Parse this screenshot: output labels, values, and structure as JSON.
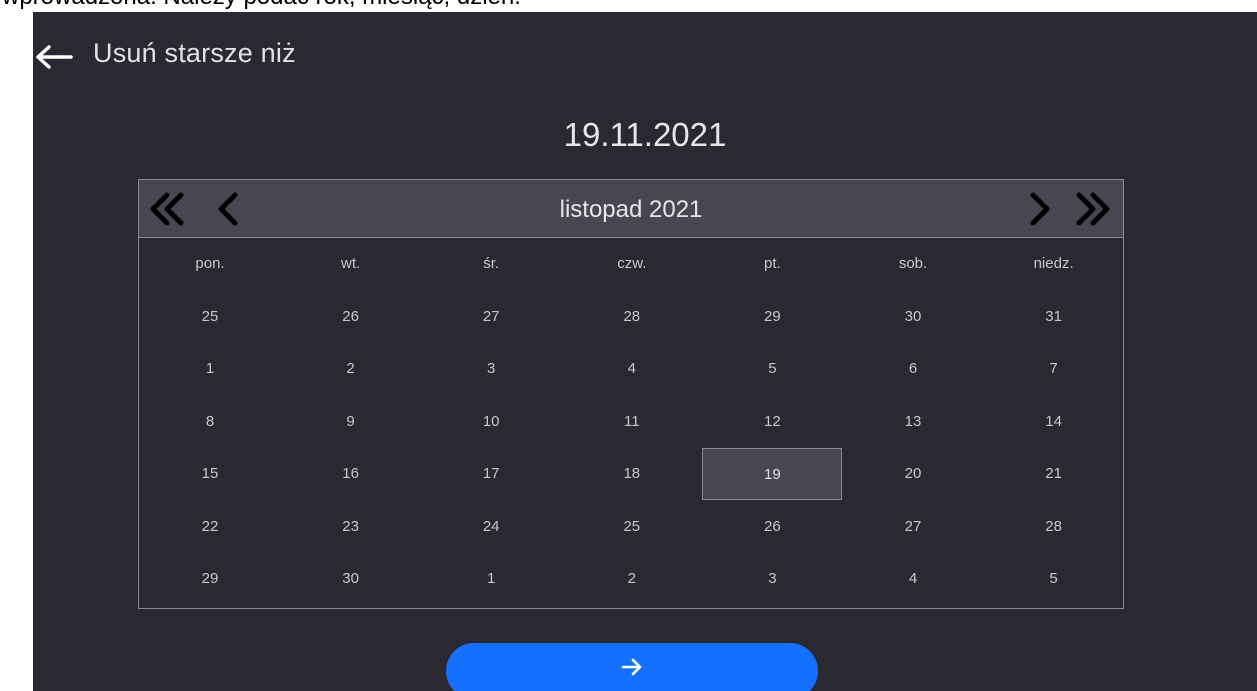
{
  "document": {
    "text": "wprowadzona. Należy podać rok, miesiąc, dzień."
  },
  "header": {
    "back_icon": "arrow-left-icon",
    "title": "Usuń starsze niż"
  },
  "selected_date": "19.11.2021",
  "calendar": {
    "month_label": "listopad 2021",
    "nav_icons": {
      "prev_year": "double-chevron-left-icon",
      "prev_month": "chevron-left-icon",
      "next_month": "chevron-right-icon",
      "next_year": "double-chevron-right-icon"
    },
    "weekdays": [
      "pon.",
      "wt.",
      "śr.",
      "czw.",
      "pt.",
      "sob.",
      "niedz."
    ],
    "weeks": [
      [
        "25",
        "26",
        "27",
        "28",
        "29",
        "30",
        "31"
      ],
      [
        "1",
        "2",
        "3",
        "4",
        "5",
        "6",
        "7"
      ],
      [
        "8",
        "9",
        "10",
        "11",
        "12",
        "13",
        "14"
      ],
      [
        "15",
        "16",
        "17",
        "18",
        "19",
        "20",
        "21"
      ],
      [
        "22",
        "23",
        "24",
        "25",
        "26",
        "27",
        "28"
      ],
      [
        "29",
        "30",
        "1",
        "2",
        "3",
        "4",
        "5"
      ]
    ],
    "selected_day": "19"
  },
  "confirm_button": {
    "icon": "arrow-right-icon"
  },
  "colors": {
    "background": "#2a2932",
    "calendar_header": "#474751",
    "accent": "#1670ff",
    "text": "#e6e6ea"
  }
}
